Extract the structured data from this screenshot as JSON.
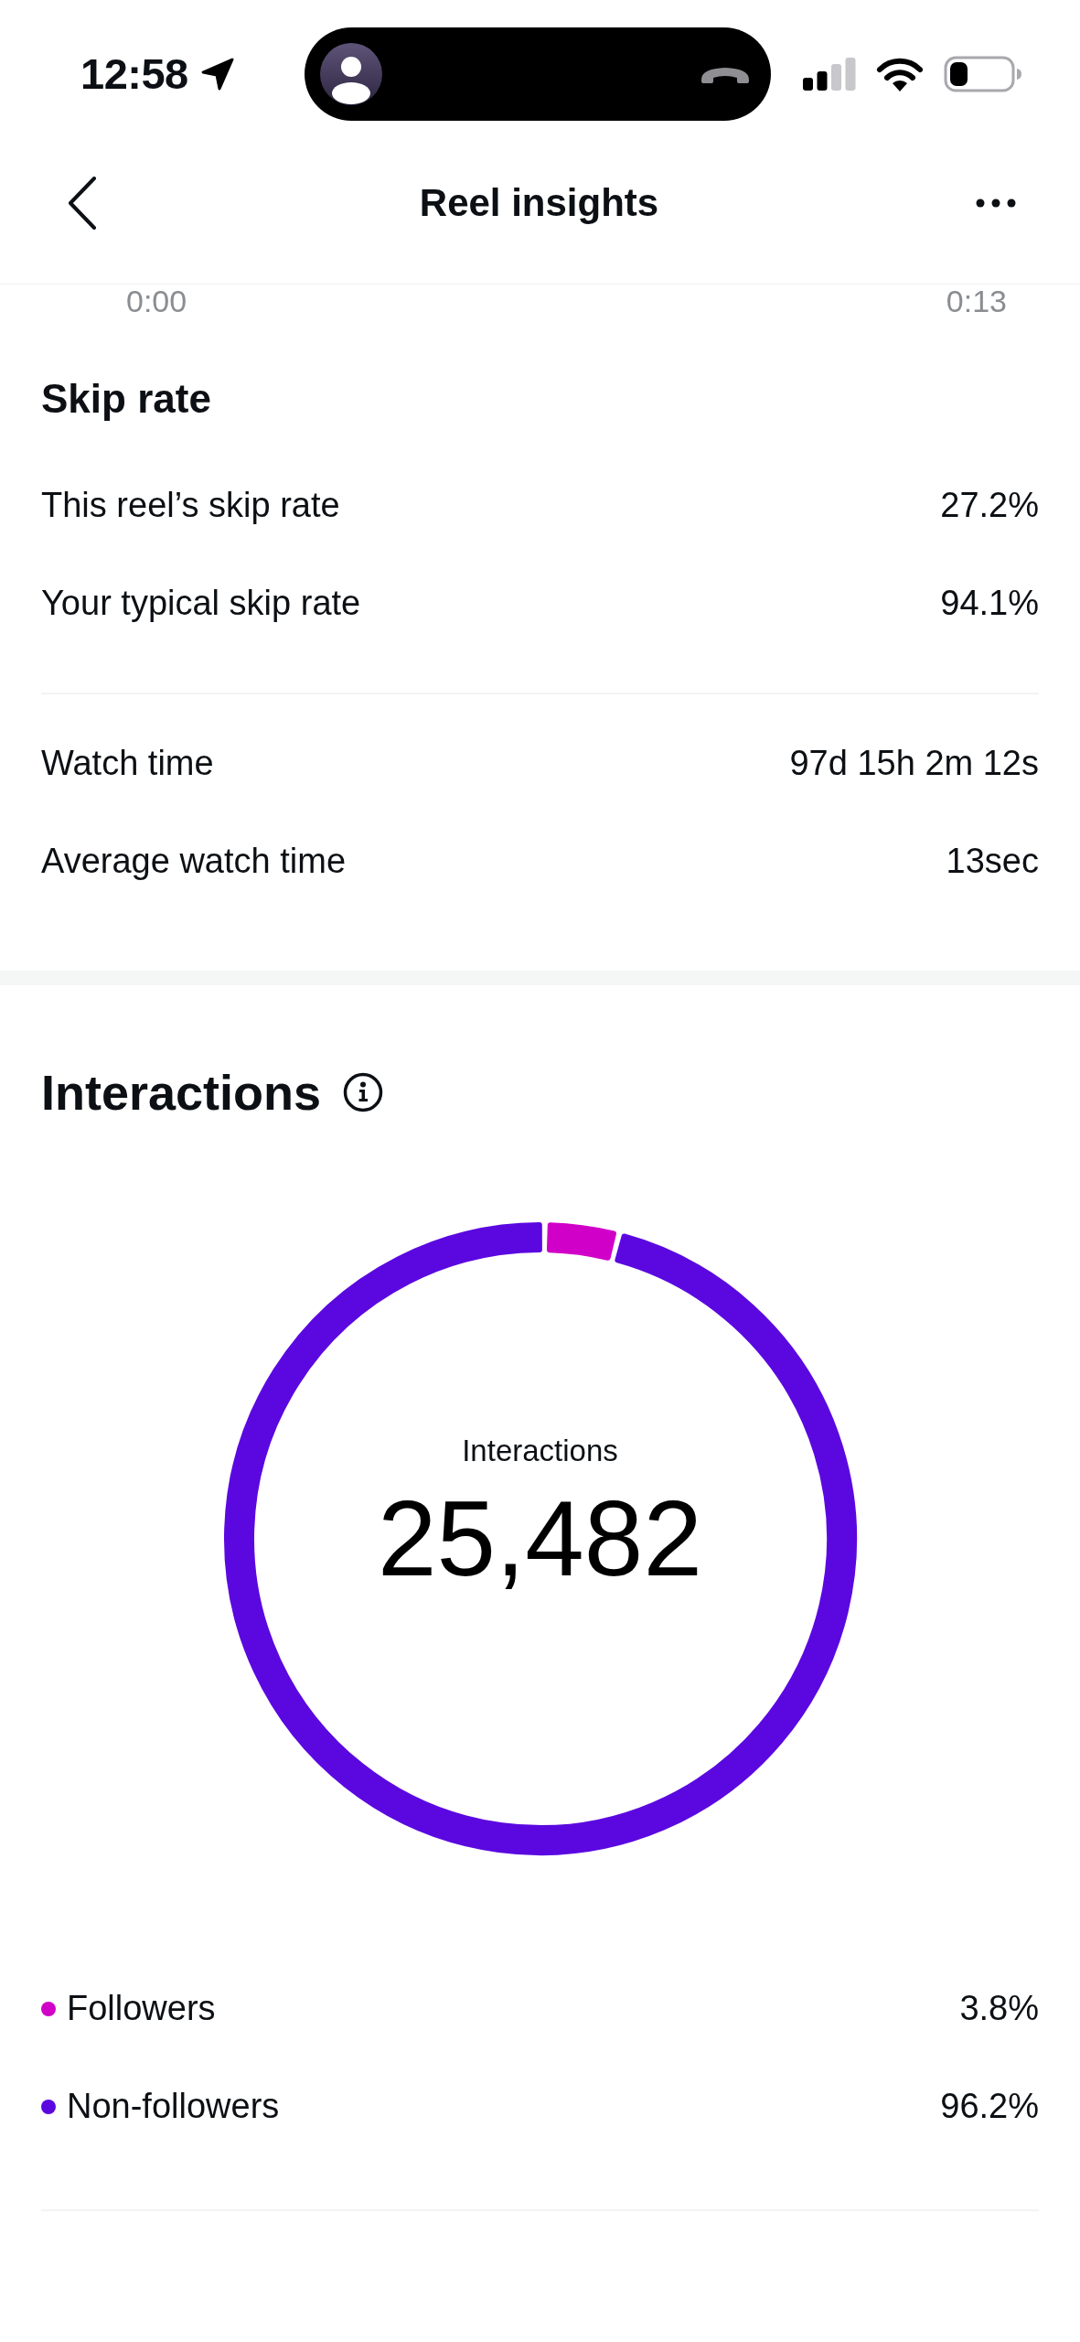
{
  "status_bar": {
    "time": "12:58"
  },
  "header": {
    "title": "Reel insights"
  },
  "timeline_labels": [
    "0:00",
    "0:13"
  ],
  "skip_rate": {
    "title": "Skip rate",
    "rows": [
      {
        "label": "This reel’s skip rate",
        "value": "27.2%"
      },
      {
        "label": "Your typical skip rate",
        "value": "94.1%"
      }
    ]
  },
  "watch": {
    "rows": [
      {
        "label": "Watch time",
        "value": "97d 15h 2m 12s"
      },
      {
        "label": "Average watch time",
        "value": "13sec"
      }
    ]
  },
  "interactions": {
    "title": "Interactions",
    "chart_data": {
      "type": "donut",
      "title": "Interactions",
      "categories": [
        "Followers",
        "Non-followers"
      ],
      "values": [
        3.8,
        96.2
      ]
    },
    "total": "25,482",
    "legend": [
      {
        "value": "3.8%",
        "color": "#d100c8"
      },
      {
        "value": "96.2%",
        "color": "#5b08e0"
      }
    ]
  }
}
